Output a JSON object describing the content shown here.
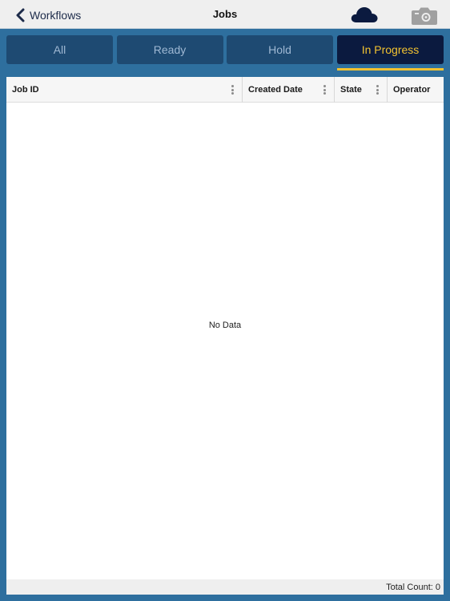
{
  "navbar": {
    "back_label": "Workflows",
    "title": "Jobs",
    "icons": {
      "back": "chevron-left-icon",
      "cloud": "cloud-icon",
      "camera": "camera-icon"
    },
    "cloud_color": "#0b1a3f",
    "camera_color": "#a0a0a0"
  },
  "tabs": [
    {
      "label": "All",
      "active": false
    },
    {
      "label": "Ready",
      "active": false
    },
    {
      "label": "Hold",
      "active": false
    },
    {
      "label": "In Progress",
      "active": true
    }
  ],
  "grid": {
    "columns": [
      {
        "label": "Job ID"
      },
      {
        "label": "Created Date"
      },
      {
        "label": "State"
      },
      {
        "label": "Operator"
      }
    ],
    "empty_message": "No Data",
    "footer": "Total Count: 0"
  },
  "colors": {
    "background": "#2e6f9e",
    "tab_inactive": "#1e4a72",
    "tab_active": "#0b1a3f",
    "accent": "#f2c230"
  }
}
